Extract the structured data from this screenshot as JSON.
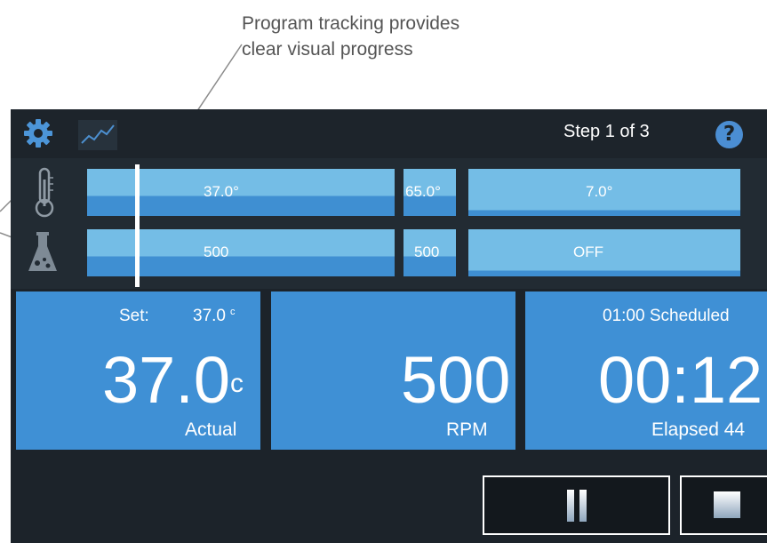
{
  "callout": {
    "line1": "Program tracking provides",
    "line2": "clear visual progress"
  },
  "header": {
    "step_text": "Step 1 of 3",
    "help_label": "?"
  },
  "icons": {
    "settings": "gear-icon",
    "graph": "graph-icon",
    "temperature": "thermometer-icon",
    "shaker": "flask-icon",
    "pause": "pause-icon",
    "stop": "stop-icon"
  },
  "program": {
    "temperature_steps": [
      "37.0°",
      "65.0°",
      "7.0°"
    ],
    "speed_steps": [
      "500",
      "500",
      "OFF"
    ],
    "current_step": 1,
    "total_steps": 3
  },
  "temperature_card": {
    "set_label": "Set:",
    "set_value": "37.0",
    "set_unit": "c",
    "actual_value": "37.0",
    "actual_unit": "c",
    "actual_label": "Actual"
  },
  "speed_card": {
    "value": "500",
    "unit_label": "RPM"
  },
  "time_card": {
    "scheduled_text": "01:00 Scheduled",
    "time_value": "00:12",
    "elapsed_text": "Elapsed 44"
  },
  "colors": {
    "panel_bg": "#1c232a",
    "card_blue": "#3f90d5",
    "segment_light": "#74bde6",
    "accent": "#4b8ed3"
  }
}
